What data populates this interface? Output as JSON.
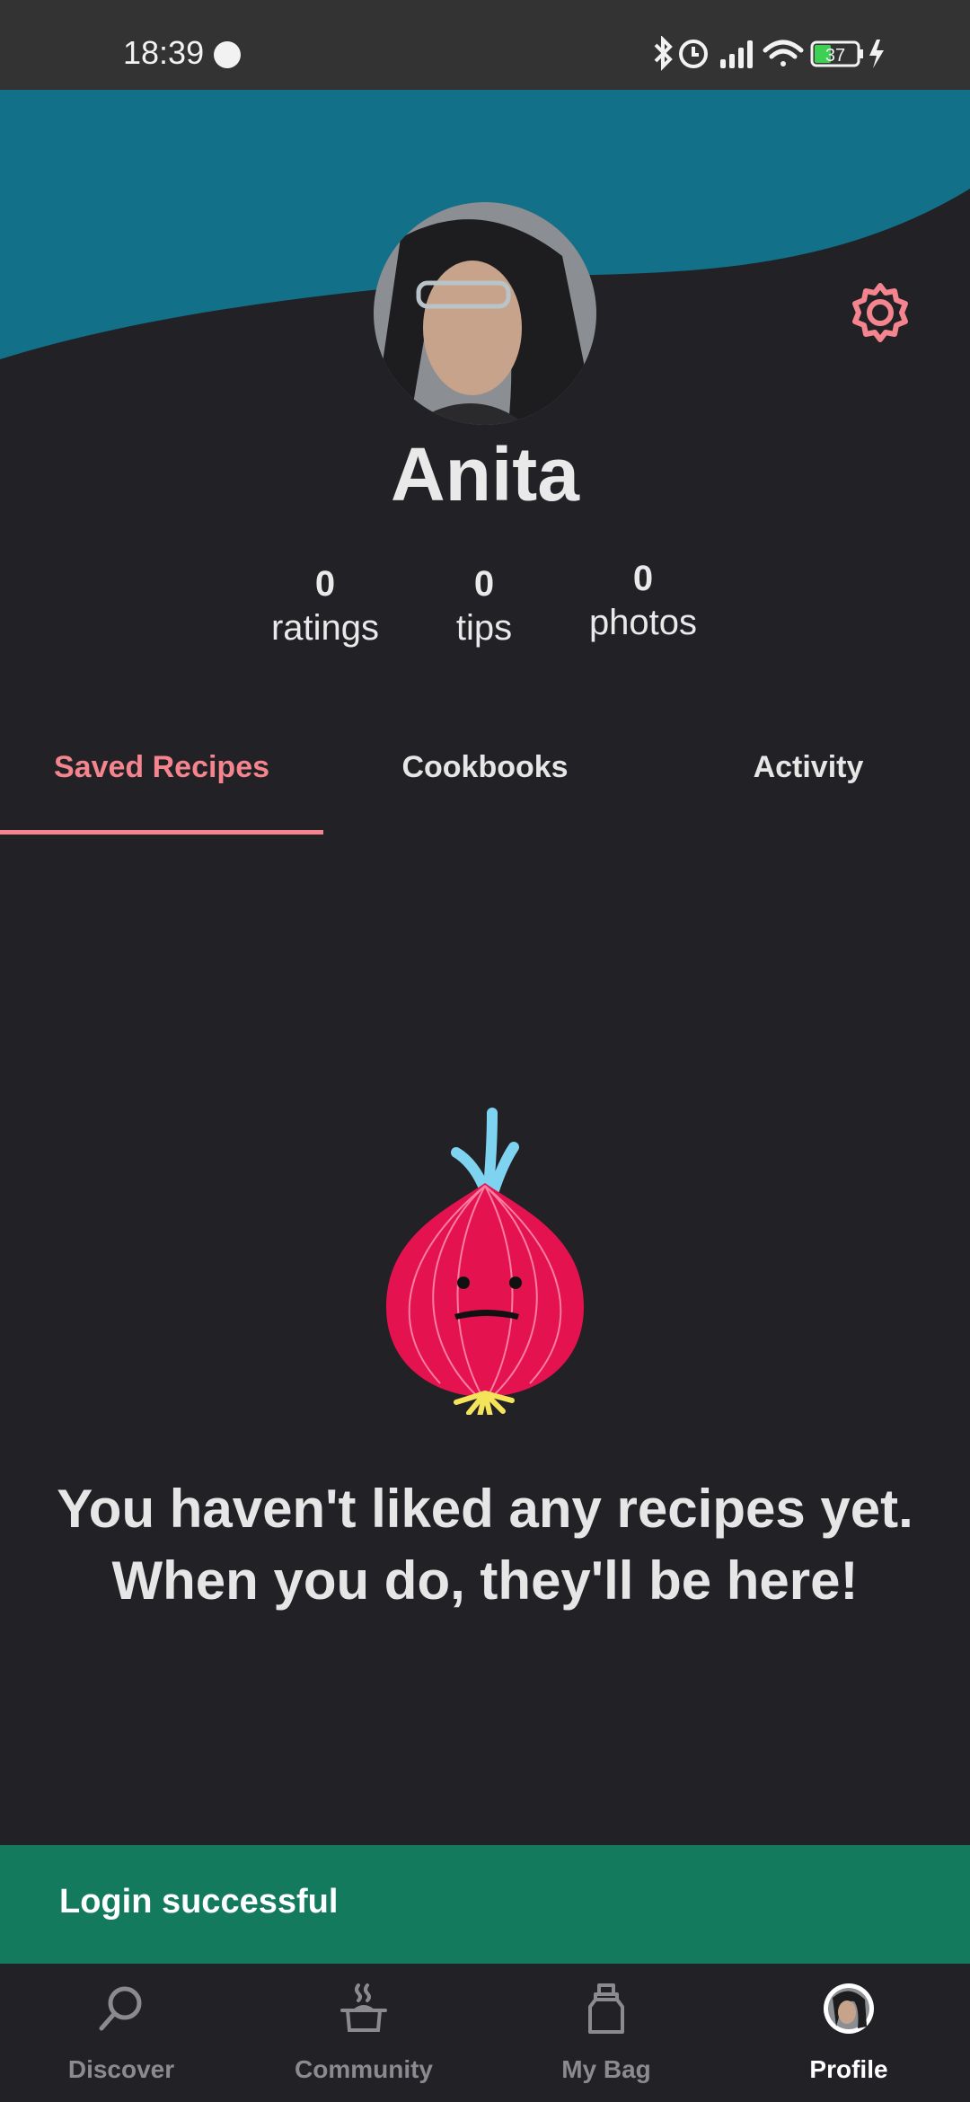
{
  "status_bar": {
    "time": "18:39",
    "battery": "37"
  },
  "profile": {
    "name": "Anita",
    "stats": [
      {
        "value": "0",
        "label": "ratings"
      },
      {
        "value": "0",
        "label": "tips"
      },
      {
        "value": "0",
        "label": "photos"
      }
    ]
  },
  "tabs": [
    {
      "label": "Saved Recipes",
      "active": true
    },
    {
      "label": "Cookbooks",
      "active": false
    },
    {
      "label": "Activity",
      "active": false
    }
  ],
  "empty_state": {
    "message": "You haven't liked any recipes yet. When you do, they'll be here!"
  },
  "toast": {
    "message": "Login successful"
  },
  "bottom_nav": {
    "items": [
      {
        "label": "Discover",
        "icon": "search-icon"
      },
      {
        "label": "Community",
        "icon": "pot-icon"
      },
      {
        "label": "My Bag",
        "icon": "bag-icon"
      },
      {
        "label": "Profile",
        "icon": "avatar-icon",
        "active": true
      }
    ]
  },
  "colors": {
    "background": "#222126",
    "header_wave": "#127089",
    "accent": "#f4848e",
    "toast": "#137a5e",
    "status_bar": "#333333"
  }
}
